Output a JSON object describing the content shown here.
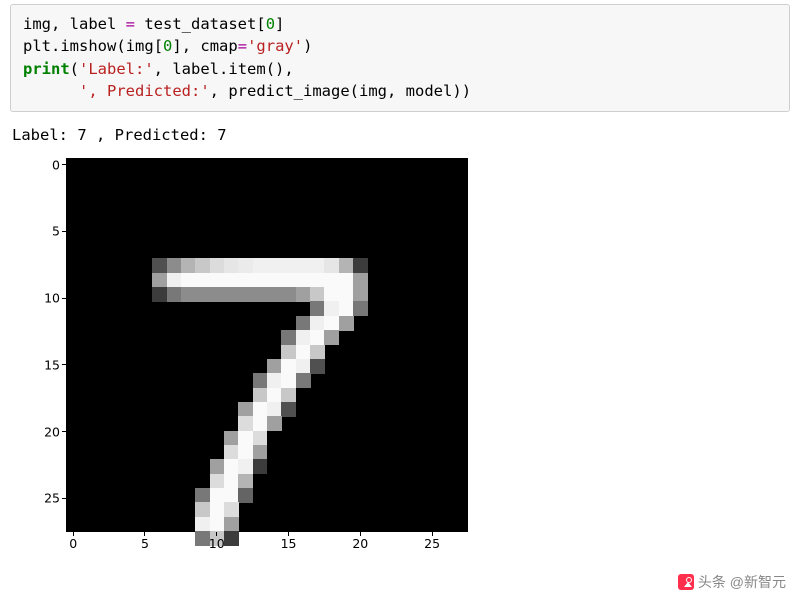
{
  "code": {
    "tok": [
      "img",
      ",",
      " label ",
      "=",
      " test_dataset",
      "[",
      "0",
      "]",
      "\n",
      "plt",
      ".",
      "imshow",
      "(",
      "img",
      "[",
      "0",
      "]",
      ",",
      " cmap",
      "=",
      "'gray'",
      ")",
      "\n",
      "print",
      "(",
      "'Label:'",
      ",",
      " label",
      ".",
      "item",
      "(",
      ")",
      ",",
      "\n",
      "      ",
      "', Predicted:'",
      ",",
      " predict_image",
      "(",
      "img",
      ",",
      " model",
      ")",
      ")"
    ],
    "cls": [
      "n",
      "n",
      "n",
      "o",
      "n",
      "n",
      "num",
      "n",
      "n",
      "n",
      "n",
      "n",
      "n",
      "n",
      "n",
      "num",
      "n",
      "n",
      "n",
      "o",
      "s",
      "n",
      "n",
      "k",
      "n",
      "s",
      "n",
      "n",
      "n",
      "n",
      "n",
      "n",
      "n",
      "n",
      "n",
      "s",
      "n",
      "n",
      "n",
      "n",
      "n",
      "n",
      "n",
      "n"
    ]
  },
  "output_line": "Label: 7 , Predicted: 7",
  "chart_data": {
    "type": "heatmap",
    "title": "",
    "xlabel": "",
    "ylabel": "",
    "xlim": [
      -0.5,
      27.5
    ],
    "ylim": [
      27.5,
      -0.5
    ],
    "xticks": [
      0,
      5,
      10,
      15,
      20,
      25
    ],
    "yticks": [
      0,
      5,
      10,
      15,
      20,
      25
    ],
    "note": "28x28 MNIST grayscale image of digit 7; 0=black, 255=white",
    "pixels_nonzero": [
      {
        "r": 7,
        "c": 6,
        "v": 80
      },
      {
        "r": 7,
        "c": 7,
        "v": 140
      },
      {
        "r": 7,
        "c": 8,
        "v": 180
      },
      {
        "r": 7,
        "c": 9,
        "v": 200
      },
      {
        "r": 7,
        "c": 10,
        "v": 220
      },
      {
        "r": 7,
        "c": 11,
        "v": 230
      },
      {
        "r": 7,
        "c": 12,
        "v": 235
      },
      {
        "r": 7,
        "c": 13,
        "v": 240
      },
      {
        "r": 7,
        "c": 14,
        "v": 240
      },
      {
        "r": 7,
        "c": 15,
        "v": 240
      },
      {
        "r": 7,
        "c": 16,
        "v": 240
      },
      {
        "r": 7,
        "c": 17,
        "v": 240
      },
      {
        "r": 7,
        "c": 18,
        "v": 230
      },
      {
        "r": 7,
        "c": 19,
        "v": 180
      },
      {
        "r": 7,
        "c": 20,
        "v": 60
      },
      {
        "r": 8,
        "c": 6,
        "v": 160
      },
      {
        "r": 8,
        "c": 7,
        "v": 240
      },
      {
        "r": 8,
        "c": 8,
        "v": 250
      },
      {
        "r": 8,
        "c": 9,
        "v": 250
      },
      {
        "r": 8,
        "c": 10,
        "v": 250
      },
      {
        "r": 8,
        "c": 11,
        "v": 250
      },
      {
        "r": 8,
        "c": 12,
        "v": 250
      },
      {
        "r": 8,
        "c": 13,
        "v": 250
      },
      {
        "r": 8,
        "c": 14,
        "v": 250
      },
      {
        "r": 8,
        "c": 15,
        "v": 250
      },
      {
        "r": 8,
        "c": 16,
        "v": 250
      },
      {
        "r": 8,
        "c": 17,
        "v": 250
      },
      {
        "r": 8,
        "c": 18,
        "v": 250
      },
      {
        "r": 8,
        "c": 19,
        "v": 250
      },
      {
        "r": 8,
        "c": 20,
        "v": 160
      },
      {
        "r": 9,
        "c": 6,
        "v": 60
      },
      {
        "r": 9,
        "c": 7,
        "v": 120
      },
      {
        "r": 9,
        "c": 8,
        "v": 140
      },
      {
        "r": 9,
        "c": 9,
        "v": 140
      },
      {
        "r": 9,
        "c": 10,
        "v": 140
      },
      {
        "r": 9,
        "c": 11,
        "v": 140
      },
      {
        "r": 9,
        "c": 12,
        "v": 140
      },
      {
        "r": 9,
        "c": 13,
        "v": 140
      },
      {
        "r": 9,
        "c": 14,
        "v": 140
      },
      {
        "r": 9,
        "c": 15,
        "v": 140
      },
      {
        "r": 9,
        "c": 16,
        "v": 160
      },
      {
        "r": 9,
        "c": 17,
        "v": 200
      },
      {
        "r": 9,
        "c": 18,
        "v": 250
      },
      {
        "r": 9,
        "c": 19,
        "v": 250
      },
      {
        "r": 9,
        "c": 20,
        "v": 160
      },
      {
        "r": 10,
        "c": 17,
        "v": 120
      },
      {
        "r": 10,
        "c": 18,
        "v": 240
      },
      {
        "r": 10,
        "c": 19,
        "v": 250
      },
      {
        "r": 10,
        "c": 20,
        "v": 120
      },
      {
        "r": 11,
        "c": 16,
        "v": 120
      },
      {
        "r": 11,
        "c": 17,
        "v": 240
      },
      {
        "r": 11,
        "c": 18,
        "v": 250
      },
      {
        "r": 11,
        "c": 19,
        "v": 160
      },
      {
        "r": 12,
        "c": 15,
        "v": 120
      },
      {
        "r": 12,
        "c": 16,
        "v": 240
      },
      {
        "r": 12,
        "c": 17,
        "v": 250
      },
      {
        "r": 12,
        "c": 18,
        "v": 160
      },
      {
        "r": 13,
        "c": 15,
        "v": 200
      },
      {
        "r": 13,
        "c": 16,
        "v": 250
      },
      {
        "r": 13,
        "c": 17,
        "v": 200
      },
      {
        "r": 14,
        "c": 14,
        "v": 160
      },
      {
        "r": 14,
        "c": 15,
        "v": 250
      },
      {
        "r": 14,
        "c": 16,
        "v": 240
      },
      {
        "r": 14,
        "c": 17,
        "v": 80
      },
      {
        "r": 15,
        "c": 13,
        "v": 120
      },
      {
        "r": 15,
        "c": 14,
        "v": 240
      },
      {
        "r": 15,
        "c": 15,
        "v": 250
      },
      {
        "r": 15,
        "c": 16,
        "v": 120
      },
      {
        "r": 16,
        "c": 13,
        "v": 200
      },
      {
        "r": 16,
        "c": 14,
        "v": 250
      },
      {
        "r": 16,
        "c": 15,
        "v": 200
      },
      {
        "r": 17,
        "c": 12,
        "v": 160
      },
      {
        "r": 17,
        "c": 13,
        "v": 250
      },
      {
        "r": 17,
        "c": 14,
        "v": 240
      },
      {
        "r": 17,
        "c": 15,
        "v": 80
      },
      {
        "r": 18,
        "c": 12,
        "v": 220
      },
      {
        "r": 18,
        "c": 13,
        "v": 250
      },
      {
        "r": 18,
        "c": 14,
        "v": 160
      },
      {
        "r": 19,
        "c": 11,
        "v": 160
      },
      {
        "r": 19,
        "c": 12,
        "v": 250
      },
      {
        "r": 19,
        "c": 13,
        "v": 220
      },
      {
        "r": 20,
        "c": 11,
        "v": 220
      },
      {
        "r": 20,
        "c": 12,
        "v": 250
      },
      {
        "r": 20,
        "c": 13,
        "v": 160
      },
      {
        "r": 21,
        "c": 10,
        "v": 160
      },
      {
        "r": 21,
        "c": 11,
        "v": 250
      },
      {
        "r": 21,
        "c": 12,
        "v": 240
      },
      {
        "r": 21,
        "c": 13,
        "v": 60
      },
      {
        "r": 22,
        "c": 10,
        "v": 220
      },
      {
        "r": 22,
        "c": 11,
        "v": 250
      },
      {
        "r": 22,
        "c": 12,
        "v": 180
      },
      {
        "r": 23,
        "c": 9,
        "v": 120
      },
      {
        "r": 23,
        "c": 10,
        "v": 250
      },
      {
        "r": 23,
        "c": 11,
        "v": 250
      },
      {
        "r": 23,
        "c": 12,
        "v": 100
      },
      {
        "r": 24,
        "c": 9,
        "v": 200
      },
      {
        "r": 24,
        "c": 10,
        "v": 250
      },
      {
        "r": 24,
        "c": 11,
        "v": 220
      },
      {
        "r": 25,
        "c": 9,
        "v": 240
      },
      {
        "r": 25,
        "c": 10,
        "v": 250
      },
      {
        "r": 25,
        "c": 11,
        "v": 160
      },
      {
        "r": 26,
        "c": 9,
        "v": 120
      },
      {
        "r": 26,
        "c": 10,
        "v": 200
      },
      {
        "r": 26,
        "c": 11,
        "v": 60
      }
    ]
  },
  "watermark": "头条 @新智元"
}
